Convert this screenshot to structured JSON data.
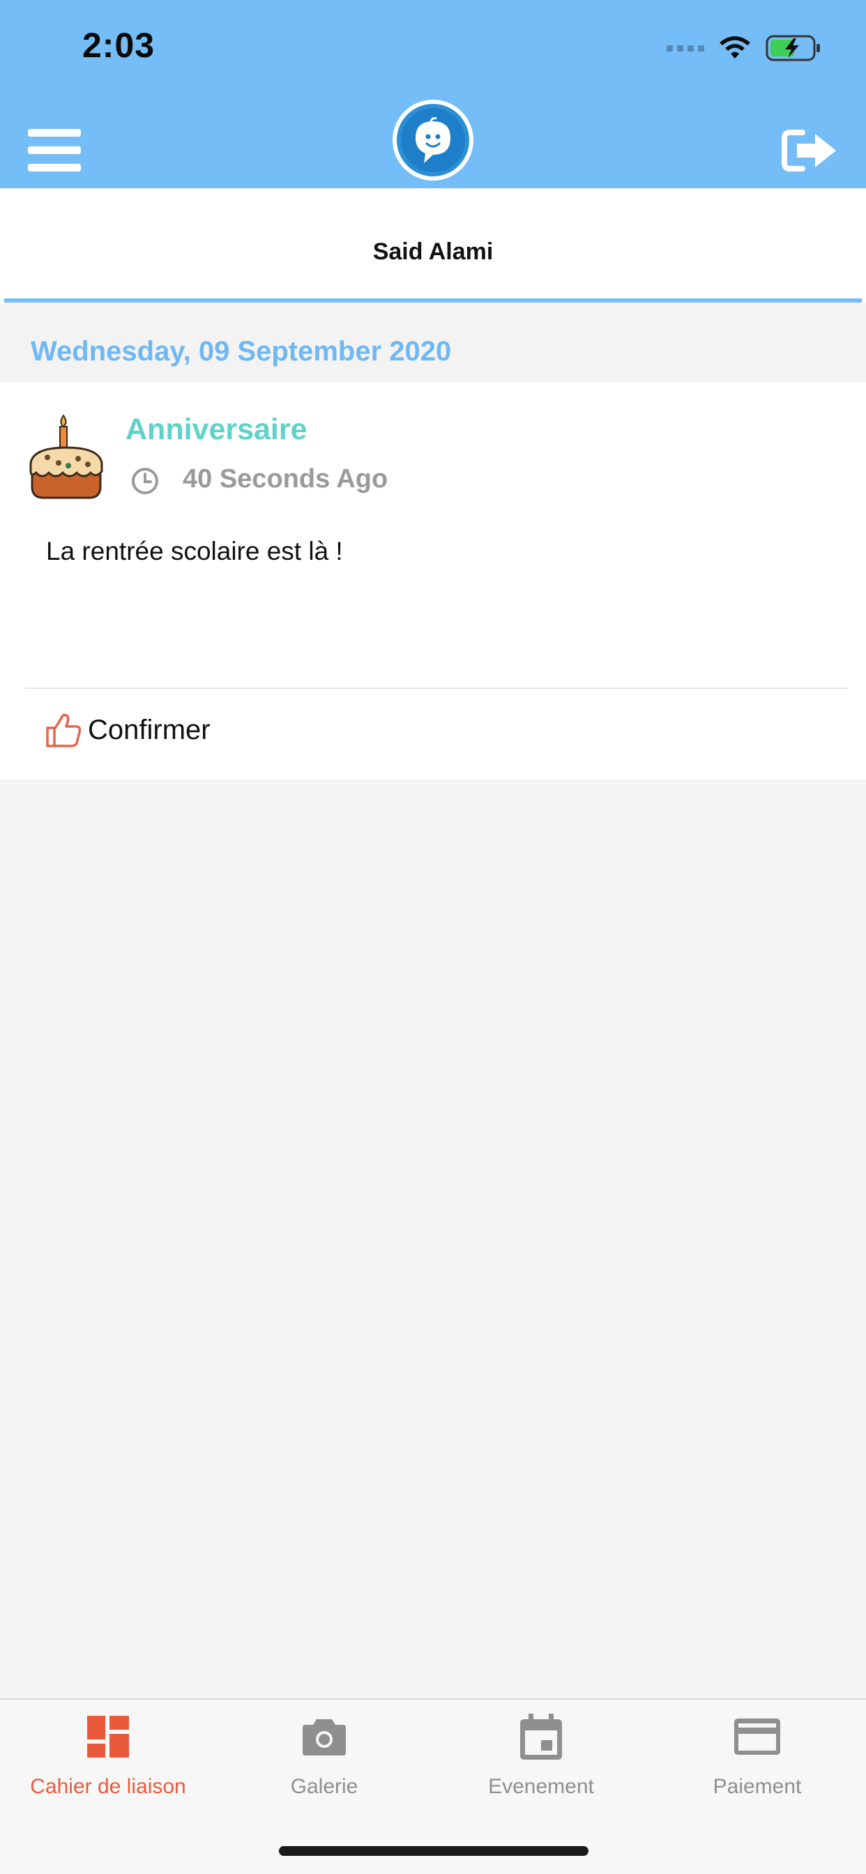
{
  "status_bar": {
    "time": "2:03",
    "icons": [
      "signal-icon",
      "wifi-icon",
      "battery-charging-icon"
    ]
  },
  "header": {
    "menu_icon": "hamburger-menu-icon",
    "logo_icon": "baby-chat-logo",
    "logout_icon": "logout-icon",
    "background_color": "#75bdf7"
  },
  "child_tab": {
    "name": "Said Alami"
  },
  "feed": {
    "date_header": "Wednesday, 09 September 2020",
    "posts": [
      {
        "icon": "birthday-cake-icon",
        "title": "Anniversaire",
        "time_icon": "clock-icon",
        "time_ago": "40 Seconds Ago",
        "body": "La rentrée scolaire est là !",
        "confirm_icon": "thumbs-up-icon",
        "confirm_label": "Confirmer"
      }
    ]
  },
  "tabbar": {
    "tabs": [
      {
        "label": "Cahier de liaison",
        "icon": "dashboard-icon",
        "active": true
      },
      {
        "label": "Galerie",
        "icon": "camera-icon",
        "active": false
      },
      {
        "label": "Evenement",
        "icon": "calendar-icon",
        "active": false
      },
      {
        "label": "Paiement",
        "icon": "credit-card-icon",
        "active": false
      }
    ],
    "active_color": "#e95a3c",
    "inactive_color": "#8f8f8f"
  }
}
